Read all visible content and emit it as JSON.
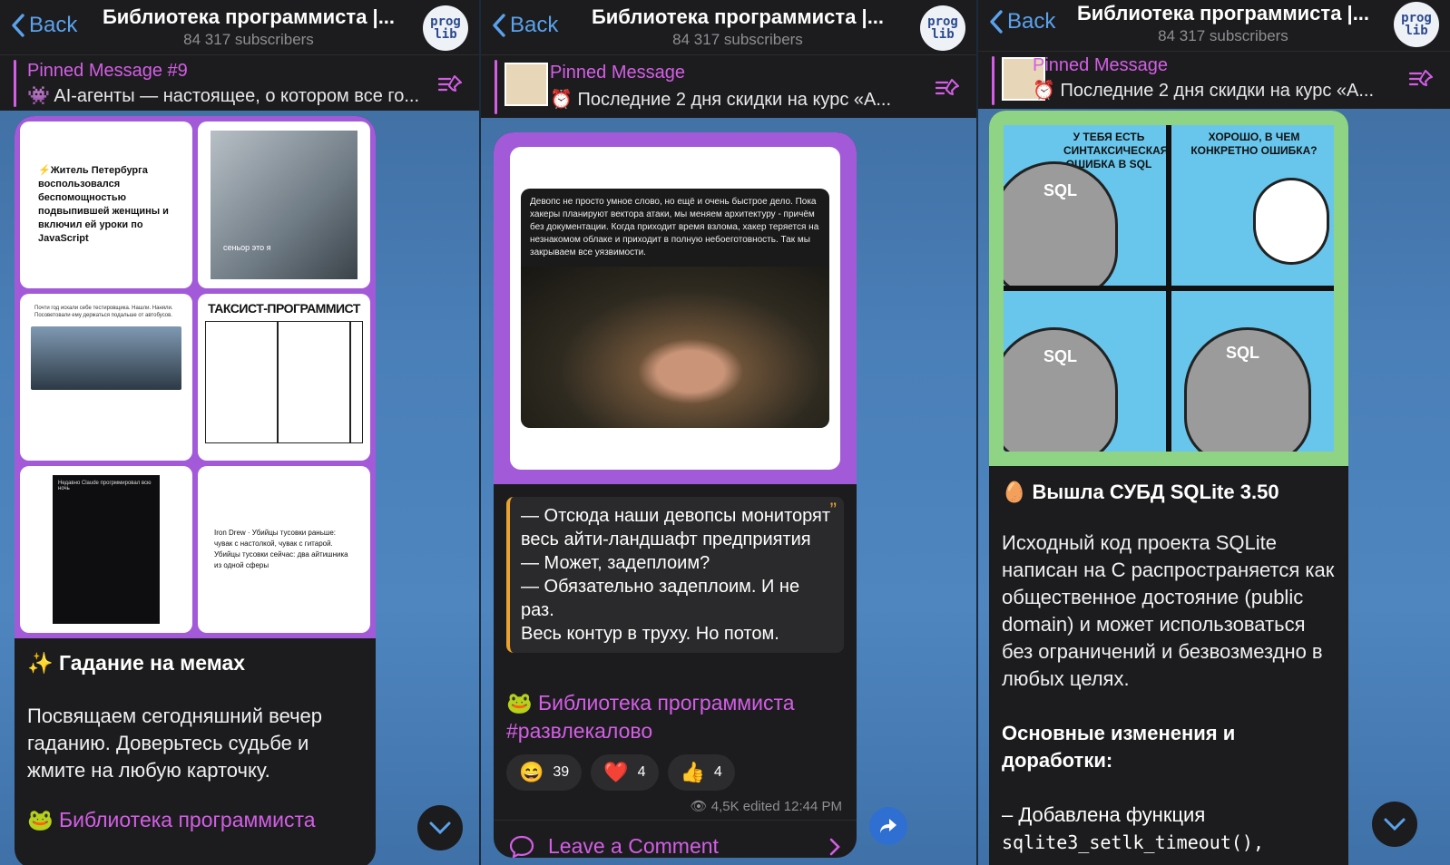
{
  "header": {
    "back_label": "Back",
    "title": "Библиотека программиста |...",
    "subscribers": "84 317 subscribers",
    "avatar_line1": "prog",
    "avatar_line2": "lib"
  },
  "panel1": {
    "pinned_label": "Pinned Message #9",
    "pinned_text": "👾 AI-агенты — настоящее, о котором все го...",
    "cards": [
      "⚡Житель Петербурга воспользовался беспомощностью подвыпившей женщины и включил ей уроки по JavaScript",
      "сеньор это я",
      "Почти год искали себе тестировщика. Нашли. Наняли. Посоветовали ему держаться подальше от автобусов.",
      "ТАКСИСТ-ПРОГРАММИСТ",
      "Недавно Claude прогрммировал всю ночь",
      "Iron Drew · Убийцы тусовки раньше: чувак с настолкой, чувак с гитарой. Убийцы тусовки сейчас: два айтишника из одной сферы"
    ],
    "caption_title": "✨ Гадание на мемах",
    "caption_text": "Посвящаем сегодняшний вечер гаданию. Доверьтесь судьбе и жмите на любую карточку.",
    "caption_link": "🐸 Библиотека программиста"
  },
  "panel2": {
    "pinned_label": "Pinned Message",
    "pinned_text": "⏰ Последние 2 дня скидки на курс «А...",
    "meme_text": "Девопс не просто умное слово, но ещё и очень быстрое дело. Пока хакеры планируют вектора атаки, мы меняем архитектуру - причём без документации. Когда приходит время взлома, хакер теряется на незнакомом облаке и приходит в полную небоеготовность. Так мы закрываем все уязвимости.",
    "quote_lines": [
      "— Отсюда наши девопсы мониторят",
      "весь айти-ландшафт предприятия",
      "— Может, задеплоим?",
      "— Обязательно задеплоим. И не раз.",
      "Весь контур в труху. Но потом."
    ],
    "link1": "🐸 Библиотека программиста",
    "link2": "#развлекалово",
    "reactions": [
      {
        "emoji": "😄",
        "count": "39"
      },
      {
        "emoji": "❤️",
        "count": "4"
      },
      {
        "emoji": "👍",
        "count": "4"
      }
    ],
    "meta": "👁 4,5K edited 12:44 PM",
    "comment_label": "Leave a Comment"
  },
  "panel3": {
    "pinned_label": "Pinned Message",
    "pinned_text": "⏰ Последние 2 дня скидки на курс «А...",
    "bubble1": "У ТЕБЯ ЕСТЬ СИНТАКСИЧЕСКАЯ ОШИБКА В SQL",
    "bubble2": "ХОРОШО, В ЧЕМ КОНКРЕТНО ОШИБКА?",
    "sql": "SQL",
    "title": "🥚 Вышла СУБД SQLite 3.50",
    "text": "Исходный код проекта SQLite написан на C распространяется как общественное достояние (public domain) и может использоваться без ограничений и безвозмездно в любых целях.",
    "subheading": "Основные изменения и доработки:",
    "item": "– Добавлена функция",
    "code": "sqlite3_setlk_timeout(),"
  },
  "colors": {
    "accent_pink": "#d35ee5",
    "link_blue": "#5aa2ec",
    "bubble_bg": "#1c1c1e",
    "quote_bar": "#e8a230"
  }
}
